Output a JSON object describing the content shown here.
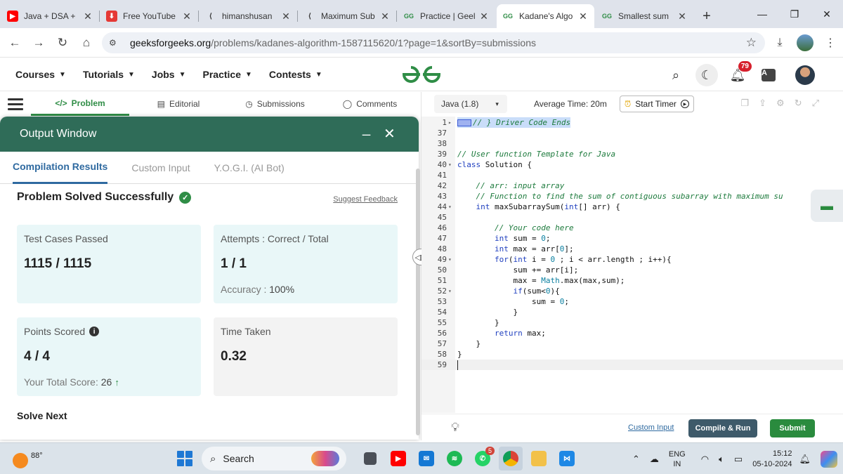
{
  "browser": {
    "tabs": [
      {
        "title": "Java + DSA +",
        "icon": "youtube-icon",
        "color": "#ff0000"
      },
      {
        "title": "Free YouTube",
        "icon": "download-icon",
        "color": "#e53935"
      },
      {
        "title": "himanshusan",
        "icon": "lovable-icon",
        "color": "#333333"
      },
      {
        "title": "Maximum Sub",
        "icon": "lovable-icon",
        "color": "#333333"
      },
      {
        "title": "Practice | Geel",
        "icon": "gfg-icon",
        "color": "#2f8d46"
      },
      {
        "title": "Kadane's Algo",
        "icon": "gfg-icon",
        "color": "#2f8d46",
        "active": true
      },
      {
        "title": "Smallest sum",
        "icon": "gfg-icon",
        "color": "#2f8d46"
      }
    ],
    "url_host": "geeksforgeeks.org",
    "url_path": "/problems/kadanes-algorithm-1587115620/1?page=1&sortBy=submissions"
  },
  "header": {
    "nav": [
      "Courses",
      "Tutorials",
      "Jobs",
      "Practice",
      "Contests"
    ],
    "notification_count": "79",
    "brand_color": "#2f8d46"
  },
  "subtabs": [
    {
      "label": "Problem",
      "icon": "</>"
    },
    {
      "label": "Editorial",
      "icon": "▤"
    },
    {
      "label": "Submissions",
      "icon": "◷"
    },
    {
      "label": "Comments",
      "icon": "◯"
    }
  ],
  "output": {
    "title": "Output Window",
    "minimize": "_",
    "close": "✕",
    "tabs": [
      "Compilation Results",
      "Custom Input",
      "Y.O.G.I. (AI Bot)"
    ],
    "status": "Problem Solved Successfully",
    "suggest_feedback": "Suggest Feedback",
    "cards": {
      "test_cases": {
        "label": "Test Cases Passed",
        "value": "1115 / 1115"
      },
      "attempts": {
        "label": "Attempts : Correct / Total",
        "value": "1 / 1",
        "accuracy_label": "Accuracy :",
        "accuracy": "100%"
      },
      "points": {
        "label": "Points Scored",
        "value": "4 / 4",
        "total_label": "Your Total Score:",
        "total": "26"
      },
      "time": {
        "label": "Time Taken",
        "value": "0.32"
      }
    },
    "solve_next": "Solve Next"
  },
  "editor": {
    "language": "Java (1.8)",
    "avg_time": "Average Time: 20m",
    "start_timer": "Start Timer",
    "lines": [
      {
        "n": "1",
        "fold": "▸",
        "hl": true,
        "folded": true,
        "t": [
          [
            "cm",
            "// } Driver Code Ends"
          ]
        ]
      },
      {
        "n": "37",
        "t": []
      },
      {
        "n": "38",
        "t": []
      },
      {
        "n": "39",
        "t": [
          [
            "cm",
            "// User function Template for Java"
          ]
        ]
      },
      {
        "n": "40",
        "fold": "▾",
        "t": [
          [
            "kw",
            "class"
          ],
          [
            "",
            " Solution {"
          ]
        ]
      },
      {
        "n": "41",
        "t": []
      },
      {
        "n": "42",
        "t": [
          [
            "",
            "    "
          ],
          [
            "cm",
            "// arr: input array"
          ]
        ]
      },
      {
        "n": "43",
        "t": [
          [
            "",
            "    "
          ],
          [
            "cm",
            "// Function to find the sum of contiguous subarray with maximum su"
          ]
        ]
      },
      {
        "n": "44",
        "fold": "▾",
        "t": [
          [
            "",
            "    "
          ],
          [
            "kw",
            "int"
          ],
          [
            "",
            " maxSubarraySum("
          ],
          [
            "kw",
            "int"
          ],
          [
            "",
            "[] arr) {"
          ]
        ]
      },
      {
        "n": "45",
        "t": []
      },
      {
        "n": "46",
        "t": [
          [
            "",
            "        "
          ],
          [
            "cm",
            "// Your code here"
          ]
        ]
      },
      {
        "n": "47",
        "t": [
          [
            "",
            "        "
          ],
          [
            "kw",
            "int"
          ],
          [
            "",
            " sum = "
          ],
          [
            "nm",
            "0"
          ],
          [
            "",
            ";"
          ]
        ]
      },
      {
        "n": "48",
        "t": [
          [
            "",
            "        "
          ],
          [
            "kw",
            "int"
          ],
          [
            "",
            " max = arr["
          ],
          [
            "nm",
            "0"
          ],
          [
            "",
            "];"
          ]
        ]
      },
      {
        "n": "49",
        "fold": "▾",
        "t": [
          [
            "",
            "        "
          ],
          [
            "kw",
            "for"
          ],
          [
            "",
            "("
          ],
          [
            "kw",
            "int"
          ],
          [
            "",
            " i = "
          ],
          [
            "nm",
            "0"
          ],
          [
            "",
            " ; i < arr.length ; i++){"
          ]
        ]
      },
      {
        "n": "50",
        "t": [
          [
            "",
            "            sum += arr[i];"
          ]
        ]
      },
      {
        "n": "51",
        "t": [
          [
            "",
            "            max = "
          ],
          [
            "nm",
            "Math"
          ],
          [
            "",
            ".max(max,sum);"
          ]
        ]
      },
      {
        "n": "52",
        "fold": "▾",
        "t": [
          [
            "",
            "            "
          ],
          [
            "kw",
            "if"
          ],
          [
            "",
            "(sum<"
          ],
          [
            "nm",
            "0"
          ],
          [
            "",
            "){"
          ]
        ]
      },
      {
        "n": "53",
        "t": [
          [
            "",
            "                sum = "
          ],
          [
            "nm",
            "0"
          ],
          [
            "",
            ";"
          ]
        ]
      },
      {
        "n": "54",
        "t": [
          [
            "",
            "            }"
          ]
        ]
      },
      {
        "n": "55",
        "t": [
          [
            "",
            "        }"
          ]
        ]
      },
      {
        "n": "56",
        "t": [
          [
            "",
            "        "
          ],
          [
            "kw",
            "return"
          ],
          [
            "",
            " max;"
          ]
        ]
      },
      {
        "n": "57",
        "t": [
          [
            "",
            "    }"
          ]
        ]
      },
      {
        "n": "58",
        "t": [
          [
            "",
            "}"
          ]
        ]
      },
      {
        "n": "59",
        "cur": true,
        "caret": true,
        "t": []
      }
    ],
    "custom_input": "Custom Input",
    "compile_run": "Compile & Run",
    "submit": "Submit"
  },
  "taskbar": {
    "temperature": "88°",
    "search": "Search",
    "whatsapp_badge": "5",
    "lang_top": "ENG",
    "lang_bottom": "IN",
    "time": "15:12",
    "date": "05-10-2024"
  }
}
